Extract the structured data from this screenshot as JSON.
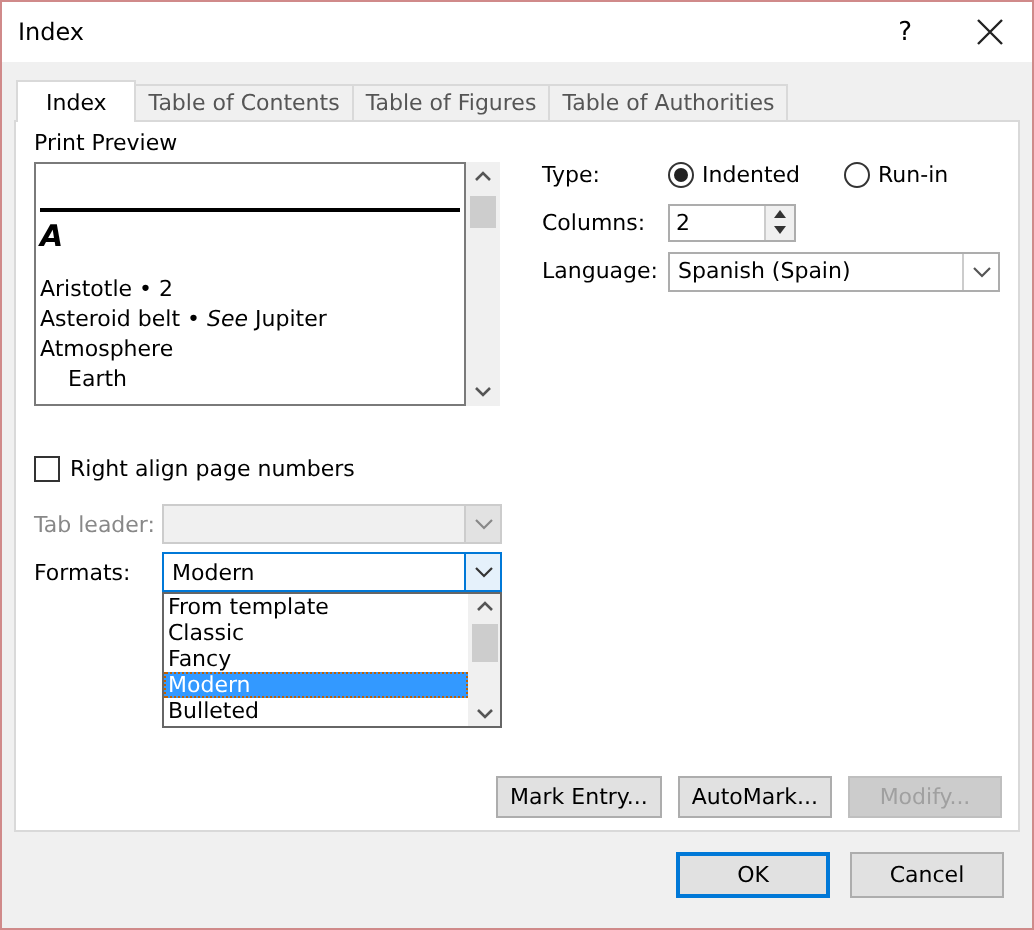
{
  "window": {
    "title": "Index",
    "help": "?"
  },
  "tabs": [
    {
      "label": "Index",
      "selected": true
    },
    {
      "label": "Table of Contents",
      "selected": false
    },
    {
      "label": "Table of Figures",
      "selected": false
    },
    {
      "label": "Table of Authorities",
      "selected": false
    }
  ],
  "print_preview": {
    "label": "Print Preview",
    "heading": "A",
    "entries": [
      {
        "text": "Aristotle • 2"
      },
      {
        "text": "Asteroid belt • *See* Jupiter"
      },
      {
        "text": "Atmosphere",
        "children": [
          {
            "text": "Earth"
          }
        ]
      }
    ]
  },
  "right_align_page_numbers": {
    "label": "Right align page numbers",
    "checked": false
  },
  "tab_leader": {
    "label": "Tab leader:",
    "disabled": true
  },
  "formats": {
    "label": "Formats:",
    "value": "Modern",
    "expanded": true,
    "options": [
      {
        "label": "From template",
        "selected": false
      },
      {
        "label": "Classic",
        "selected": false
      },
      {
        "label": "Fancy",
        "selected": false
      },
      {
        "label": "Modern",
        "selected": true
      },
      {
        "label": "Bulleted",
        "selected": false
      }
    ]
  },
  "type": {
    "label": "Type:",
    "options": [
      {
        "label": "Indented",
        "selected": true
      },
      {
        "label": "Run-in",
        "selected": false
      }
    ]
  },
  "columns": {
    "label": "Columns:",
    "value": "2"
  },
  "language": {
    "label": "Language:",
    "value": "Spanish (Spain)"
  },
  "buttons": [
    {
      "label": "Mark Entry...",
      "disabled": false
    },
    {
      "label": "AutoMark...",
      "disabled": false
    },
    {
      "label": "Modify...",
      "disabled": true
    }
  ],
  "footer_buttons": [
    {
      "label": "OK",
      "default": true
    },
    {
      "label": "Cancel",
      "default": false
    }
  ]
}
